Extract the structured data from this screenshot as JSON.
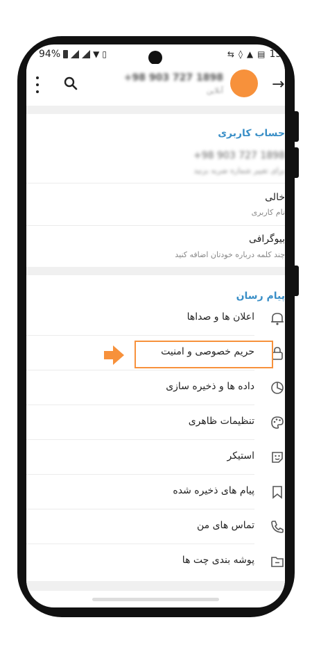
{
  "status_bar": {
    "battery": "94%",
    "time": "15:"
  },
  "header": {
    "phone_number": "+98 903 727 1898",
    "presence": "آنلاین"
  },
  "account": {
    "title": "حساب کاربری",
    "phone_number": "+98 903 727 1898",
    "phone_hint": "برای تغییر شماره ضربه بزنید",
    "username_value": "خالی",
    "username_label": "نام کاربری",
    "bio_title": "بیوگرافی",
    "bio_hint": "چند کلمه درباره خودتان اضافه کنید"
  },
  "settings": {
    "title": "پیام رسان",
    "items": [
      {
        "label": "اعلان ها و صداها",
        "icon": "bell-icon"
      },
      {
        "label": "حریم خصوصی و امنیت",
        "icon": "lock-icon"
      },
      {
        "label": "داده ها و ذخیره سازی",
        "icon": "pie-chart-icon"
      },
      {
        "label": "تنظیمات ظاهری",
        "icon": "palette-icon"
      },
      {
        "label": "استیکر",
        "icon": "sticker-icon"
      },
      {
        "label": "پیام های ذخیره شده",
        "icon": "bookmark-icon"
      },
      {
        "label": "تماس های من",
        "icon": "phone-icon"
      },
      {
        "label": "پوشه بندی چت ها",
        "icon": "folder-icon"
      }
    ],
    "highlighted_item": "حریم خصوصی و امنیت"
  },
  "colors": {
    "accent": "#3a8fc7",
    "highlight": "#f7913b",
    "avatar": "#f7913b"
  }
}
